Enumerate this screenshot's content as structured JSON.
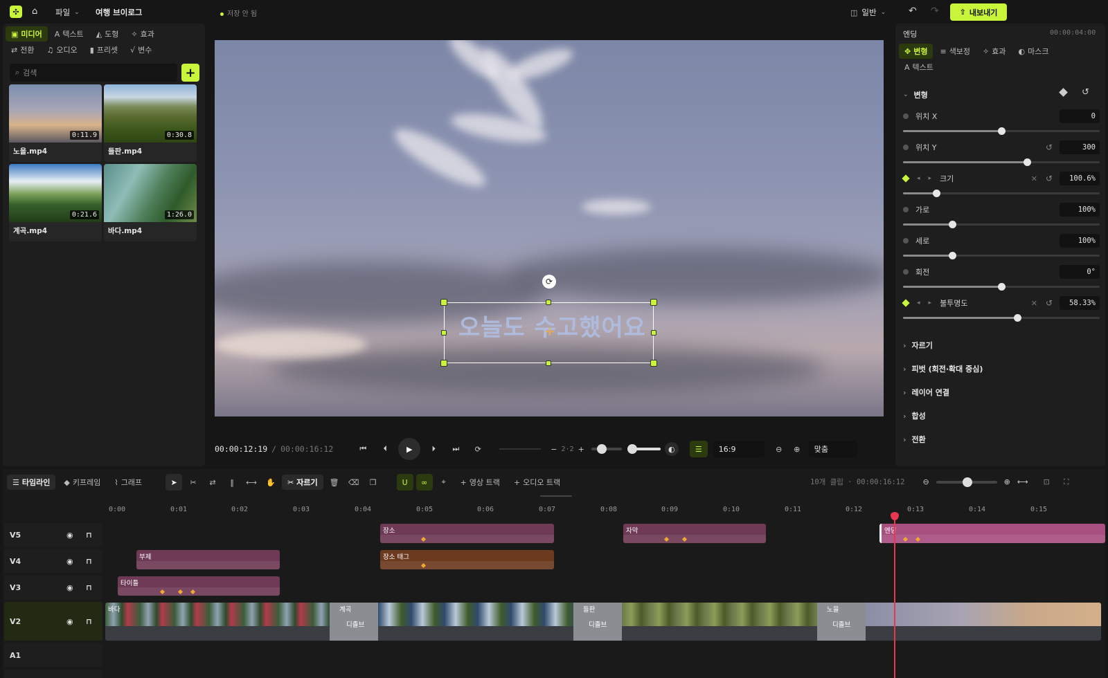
{
  "topbar": {
    "file_menu": "파일",
    "project_name": "여행 브이로그",
    "save_status": "저장 안 됨",
    "layout_mode": "일반",
    "export_label": "내보내기"
  },
  "media_panel": {
    "tabs": [
      {
        "label": "미디어",
        "icon": "media-icon"
      },
      {
        "label": "텍스트",
        "icon": "text-icon"
      },
      {
        "label": "도형",
        "icon": "shape-icon"
      },
      {
        "label": "효과",
        "icon": "effect-icon"
      },
      {
        "label": "전환",
        "icon": "transition-icon"
      },
      {
        "label": "오디오",
        "icon": "audio-icon"
      },
      {
        "label": "프리셋",
        "icon": "preset-icon"
      },
      {
        "label": "변수",
        "icon": "variable-icon"
      }
    ],
    "search_placeholder": "검색",
    "items": [
      {
        "name": "노을.mp4",
        "duration": "0:11.9"
      },
      {
        "name": "들판.mp4",
        "duration": "0:30.8"
      },
      {
        "name": "계곡.mp4",
        "duration": "0:21.6"
      },
      {
        "name": "바다.mp4",
        "duration": "1:26.0"
      }
    ]
  },
  "preview": {
    "overlay_text": "오늘도 수고했어요",
    "current_time": "00:00:12:19",
    "separator": "/",
    "total_time": "00:00:16:12",
    "speed_value": "2·2",
    "aspect_ratio": "16:9",
    "zoom_label": "맞춤"
  },
  "properties": {
    "layer_name": "엔딩",
    "layer_time": "00:00:04:00",
    "tabs": [
      {
        "label": "변형",
        "icon": "transform-icon"
      },
      {
        "label": "색보정",
        "icon": "color-icon"
      },
      {
        "label": "효과",
        "icon": "effect-icon"
      },
      {
        "label": "마스크",
        "icon": "mask-icon"
      },
      {
        "label": "텍스트",
        "icon": "text-icon"
      }
    ],
    "section_title": "변형",
    "fields": [
      {
        "label": "위치 X",
        "value": "0",
        "fraction": 0.5
      },
      {
        "label": "위치 Y",
        "value": "300",
        "fraction": 0.63
      },
      {
        "label": "크기",
        "value": "100.6%",
        "fraction": 0.17
      },
      {
        "label": "가로",
        "value": "100%",
        "fraction": 0.25
      },
      {
        "label": "세로",
        "value": "100%",
        "fraction": 0.25
      },
      {
        "label": "회전",
        "value": "0°",
        "fraction": 0.5
      },
      {
        "label": "불투명도",
        "value": "58.33%",
        "fraction": 0.58
      }
    ],
    "collapsed_sections": [
      "자르기",
      "피벗 (회전·확대 중심)",
      "레이어 연결",
      "합성",
      "전환"
    ]
  },
  "timeline": {
    "tabs": [
      {
        "label": "타임라인",
        "icon": "timeline-icon"
      },
      {
        "label": "키프레임",
        "icon": "keyframe-icon"
      },
      {
        "label": "그래프",
        "icon": "graph-icon"
      }
    ],
    "cut_label": "자르기",
    "add_video_track": "영상 트랙",
    "add_audio_track": "오디오 트랙",
    "summary": "10개 클립 · 00:00:16:12",
    "ruler": [
      "0:00",
      "0:01",
      "0:02",
      "0:03",
      "0:04",
      "0:05",
      "0:06",
      "0:07",
      "0:08",
      "0:09",
      "0:10",
      "0:11",
      "0:12",
      "0:13",
      "0:14",
      "0:15"
    ],
    "tracks": [
      "V5",
      "V4",
      "V3",
      "V2",
      "A1"
    ],
    "clips": {
      "v5": [
        "장소",
        "자막",
        "엔딩"
      ],
      "v4": [
        "부제",
        "장소 태그"
      ],
      "v3": [
        "타이틀"
      ],
      "v2": [
        "바다",
        "계곡",
        "들판",
        "노을"
      ],
      "transition_label": "디졸브"
    }
  },
  "colors": {
    "accent": "#c8f53a",
    "clip_pink": "#6e3a55",
    "clip_orange": "#6b3a1f",
    "playhead": "#e8384f"
  }
}
